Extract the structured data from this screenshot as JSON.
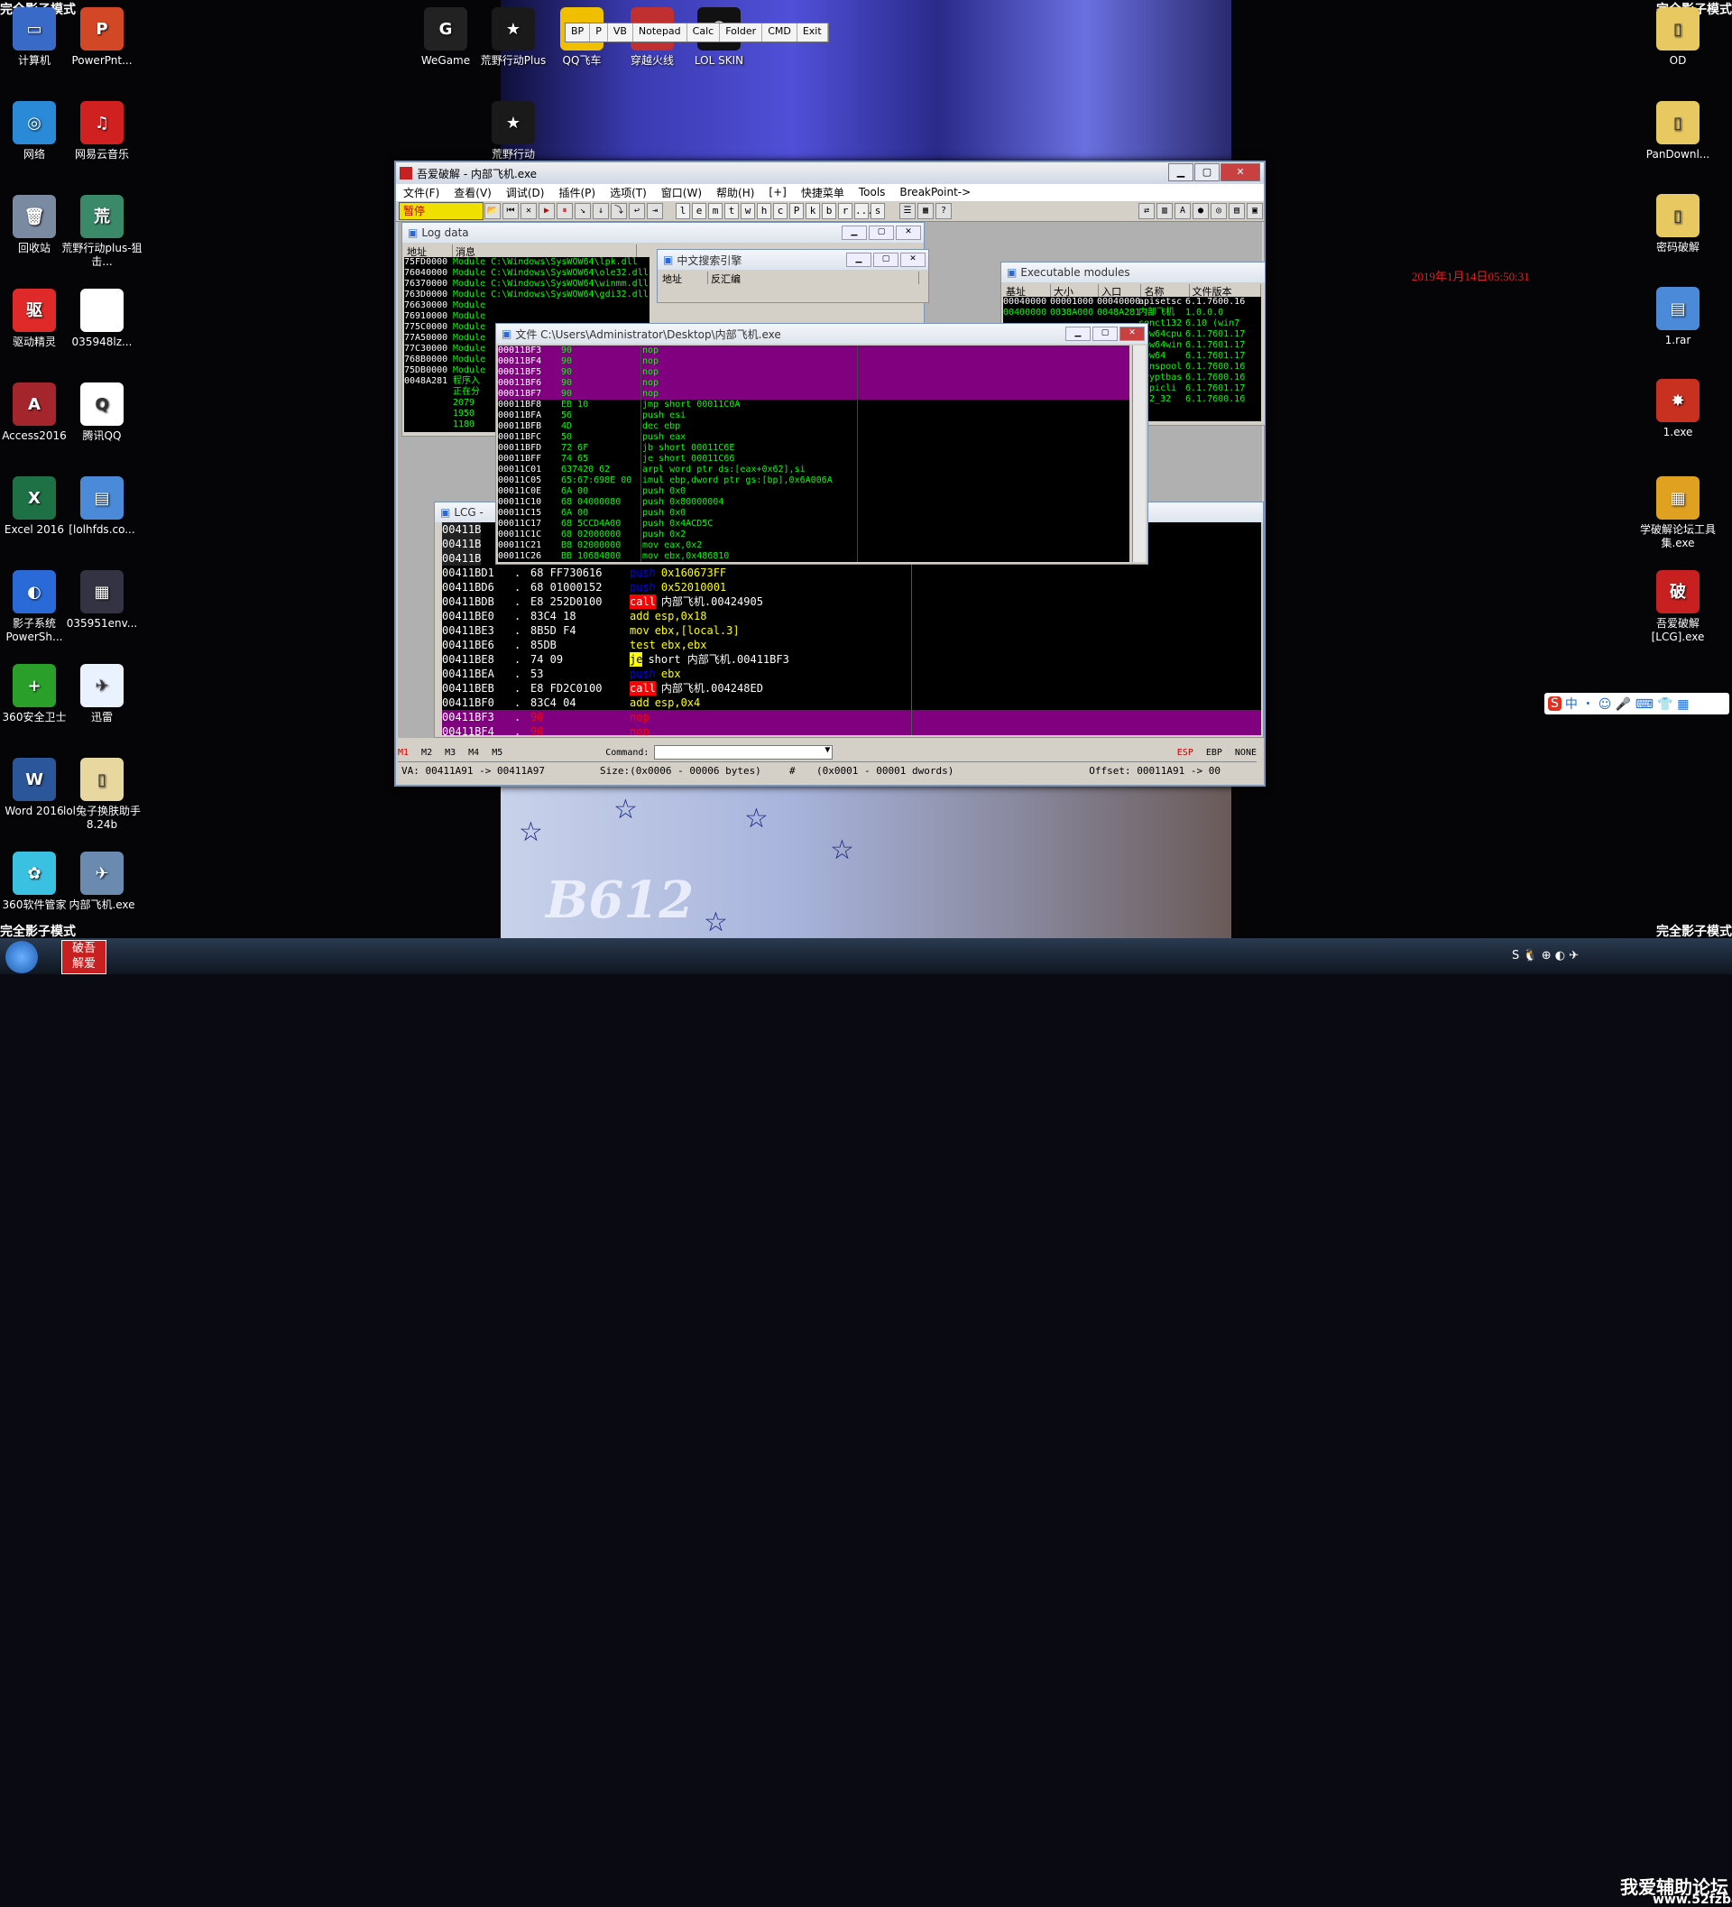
{
  "corners": {
    "tl": "完全影子模式",
    "tr": "完全影子模式",
    "bl": "完全影子模式",
    "br": "完全影子模式"
  },
  "clock": "2019年1月14日05:50:31",
  "desktop_left": [
    {
      "label": "计算机",
      "color": "#3a6ac8",
      "glyph": "▭"
    },
    {
      "label": "PowerPnt...",
      "color": "#d24726",
      "glyph": "P"
    },
    {
      "label": "网络",
      "color": "#2a8ad8",
      "glyph": "◎"
    },
    {
      "label": "网易云音乐",
      "color": "#d02020",
      "glyph": "♫"
    },
    {
      "label": "回收站",
      "color": "#7a8aa0",
      "glyph": "🗑"
    },
    {
      "label": "荒野行动plus-狙击...",
      "color": "#3a8a6a",
      "glyph": "荒"
    },
    {
      "label": "驱动精灵",
      "color": "#e02a2a",
      "glyph": "驱"
    },
    {
      "label": "035948lz...",
      "color": "#ffffff",
      "glyph": ""
    },
    {
      "label": "Access2016",
      "color": "#a4262c",
      "glyph": "A"
    },
    {
      "label": "腾讯QQ",
      "color": "#ffffff",
      "glyph": "Q"
    },
    {
      "label": "Excel 2016",
      "color": "#1e7145",
      "glyph": "X"
    },
    {
      "label": "[lolhfds.co...",
      "color": "#4a8ad8",
      "glyph": "▤"
    },
    {
      "label": "影子系统PowerSh...",
      "color": "#2a6ad8",
      "glyph": "◐"
    },
    {
      "label": "035951env...",
      "color": "#333344",
      "glyph": "▦"
    },
    {
      "label": "360安全卫士",
      "color": "#2aa02a",
      "glyph": "+"
    },
    {
      "label": "迅雷",
      "color": "#eaf2ff",
      "glyph": "✈"
    },
    {
      "label": "Word 2016",
      "color": "#2b579a",
      "glyph": "W"
    },
    {
      "label": "lol兔子换肤助手8.24b",
      "color": "#e8d8a0",
      "glyph": "▯"
    },
    {
      "label": "360软件管家",
      "color": "#3ac0e0",
      "glyph": "✿"
    },
    {
      "label": "内部飞机.exe",
      "color": "#6a8ab0",
      "glyph": "✈"
    }
  ],
  "desktop_top": [
    {
      "label": "WeGame",
      "color": "#222222",
      "glyph": "G"
    },
    {
      "label": "荒野行动Plus",
      "color": "#1a1a1a",
      "glyph": "★"
    },
    {
      "label": "QQ飞车",
      "color": "#f0c000",
      "glyph": "Q"
    },
    {
      "label": "穿越火线",
      "color": "#c03030",
      "glyph": "◉"
    },
    {
      "label": "LOL SKIN",
      "color": "#111111",
      "glyph": "☺"
    },
    {
      "label": "荒野行动",
      "color": "#1a1a1a",
      "glyph": "★"
    }
  ],
  "desktop_right": [
    {
      "label": "OD",
      "color": "#e8c860",
      "glyph": "▯"
    },
    {
      "label": "PanDownl...",
      "color": "#e8c860",
      "glyph": "▯"
    },
    {
      "label": "密码破解",
      "color": "#e8c860",
      "glyph": "▯"
    },
    {
      "label": "1.rar",
      "color": "#4a8ad8",
      "glyph": "▤"
    },
    {
      "label": "1.exe",
      "color": "#c83020",
      "glyph": "✸"
    },
    {
      "label": "学破解论坛工具集.exe",
      "color": "#e0a020",
      "glyph": "▦"
    },
    {
      "label": "吾爱破解[LCG].exe",
      "color": "#c82020",
      "glyph": "破"
    }
  ],
  "quickbar": [
    "BP",
    "P",
    "VB",
    "Notepad",
    "Calc",
    "Folder",
    "CMD",
    "Exit"
  ],
  "window": {
    "title": "吾爱破解 - 内部飞机.exe",
    "menus": [
      "文件(F)",
      "查看(V)",
      "调试(D)",
      "插件(P)",
      "选项(T)",
      "窗口(W)",
      "帮助(H)",
      "[+]",
      "快捷菜单",
      "Tools",
      "BreakPoint->"
    ],
    "pause": "暂停",
    "letters": [
      "l",
      "e",
      "m",
      "t",
      "w",
      "h",
      "c",
      "P",
      "k",
      "b",
      "r",
      "...",
      "s"
    ]
  },
  "log": {
    "title": "Log data",
    "cols": [
      "地址",
      "消息"
    ],
    "rows": [
      [
        "75FD0000",
        "Module C:\\Windows\\SysWOW64\\lpk.dll"
      ],
      [
        "76040000",
        "Module C:\\Windows\\SysWOW64\\ole32.dll"
      ],
      [
        "76370000",
        "Module C:\\Windows\\SysWOW64\\winmm.dll"
      ],
      [
        "763D0000",
        "Module C:\\Windows\\SysWOW64\\gdi32.dll"
      ],
      [
        "76630000",
        "Module"
      ],
      [
        "76910000",
        "Module"
      ],
      [
        "775C0000",
        "Module"
      ],
      [
        "77A50000",
        "Module"
      ],
      [
        "77C30000",
        "Module"
      ],
      [
        "768B0000",
        "Module"
      ],
      [
        "75DB0000",
        "Module"
      ],
      [
        "0048A281",
        "程序入"
      ],
      [
        "",
        "正在分"
      ],
      [
        "",
        "2079"
      ],
      [
        "",
        "1950"
      ],
      [
        "",
        "1180"
      ]
    ]
  },
  "search": {
    "title": "中文搜索引擎",
    "cols": [
      "地址",
      "反汇编"
    ]
  },
  "exec": {
    "title": "Executable modules",
    "cols": [
      "基址",
      "大小",
      "入口",
      "名称",
      "文件版本"
    ],
    "rows": [
      [
        "00040000",
        "00001000",
        "00040000",
        "apisetsc",
        "6.1.7600.16"
      ],
      [
        "00400000",
        "0038A000",
        "0048A281",
        "内部飞机",
        "1.0.0.0"
      ],
      [
        "",
        "",
        "",
        "conct132",
        "6.10 (win7"
      ],
      [
        "",
        "",
        "",
        "wow64cpu",
        "6.1.7601.17"
      ],
      [
        "",
        "",
        "",
        "wow64win",
        "6.1.7601.17"
      ],
      [
        "",
        "",
        "",
        "wow64",
        "6.1.7601.17"
      ],
      [
        "",
        "",
        "",
        "winspool",
        "6.1.7600.16"
      ],
      [
        "",
        "",
        "",
        "cryptbas",
        "6.1.7600.16"
      ],
      [
        "",
        "",
        "",
        "sspicli",
        "6.1.7601.17"
      ],
      [
        "",
        "",
        "",
        "ws2_32",
        "6.1.7600.16"
      ]
    ]
  },
  "file": {
    "title": "文件 C:\\Users\\Administrator\\Desktop\\内部飞机.exe",
    "rows": [
      [
        "00011BF3",
        "90",
        "nop",
        true
      ],
      [
        "00011BF4",
        "90",
        "nop",
        true
      ],
      [
        "00011BF5",
        "90",
        "nop",
        true
      ],
      [
        "00011BF6",
        "90",
        "nop",
        true
      ],
      [
        "00011BF7",
        "90",
        "nop",
        true
      ],
      [
        "00011BF8",
        "EB 10",
        "jmp short 00011C0A",
        false
      ],
      [
        "00011BFA",
        "56",
        "push esi",
        false
      ],
      [
        "00011BFB",
        "4D",
        "dec ebp",
        false
      ],
      [
        "00011BFC",
        "50",
        "push eax",
        false
      ],
      [
        "00011BFD",
        "72 6F",
        "jb short 00011C6E",
        false
      ],
      [
        "00011BFF",
        "74 65",
        "je short 00011C66",
        false
      ],
      [
        "00011C01",
        "637420 62",
        "arpl word ptr ds:[eax+0x62],si",
        false
      ],
      [
        "00011C05",
        "65:67:698E 00",
        "imul ebp,dword ptr gs:[bp],0x6A006A",
        false
      ],
      [
        "00011C0E",
        "6A 00",
        "push 0x0",
        false
      ],
      [
        "00011C10",
        "68 04000080",
        "push 0x80000004",
        false
      ],
      [
        "00011C15",
        "6A 00",
        "push 0x0",
        false
      ],
      [
        "00011C17",
        "68 5CCD4A00",
        "push 0x4ACD5C",
        false
      ],
      [
        "00011C1C",
        "68 02000000",
        "push 0x2",
        false
      ],
      [
        "00011C21",
        "B8 02000000",
        "mov eax,0x2",
        false
      ],
      [
        "00011C26",
        "BB 10684800",
        "mov ebx,0x486810",
        false
      ]
    ]
  },
  "lcg": {
    "title": "LCG -",
    "rows": [
      [
        "00411BD1",
        "68 FF730616",
        "push",
        "0x160673FF"
      ],
      [
        "00411BD6",
        "68 01000152",
        "push",
        "0x52010001"
      ],
      [
        "00411BDB",
        "E8 252D0100",
        "call",
        "内部飞机.00424905"
      ],
      [
        "00411BE0",
        "83C4 18",
        "add",
        "esp,0x18"
      ],
      [
        "00411BE3",
        "8B5D F4",
        "mov",
        "ebx,[local.3]"
      ],
      [
        "00411BE6",
        "85DB",
        "test",
        "ebx,ebx"
      ],
      [
        "00411BE8",
        "74 09",
        "je",
        "short 内部飞机.00411BF3"
      ],
      [
        "00411BEA",
        "53",
        "push",
        "ebx"
      ],
      [
        "00411BEB",
        "E8 FD2C0100",
        "call",
        "内部飞机.004248ED"
      ],
      [
        "00411BF0",
        "83C4 04",
        "add",
        "esp,0x4"
      ],
      [
        "00411BF3",
        "90",
        "nop",
        ""
      ],
      [
        "00411BF4",
        "90",
        "nop",
        ""
      ]
    ],
    "top_rows": [
      "00411B",
      "00411B",
      "00411B"
    ]
  },
  "cmdbar": {
    "tabs": [
      "M1",
      "M2",
      "M3",
      "M4",
      "M5"
    ],
    "command_label": "Command:",
    "regs": [
      "ESP",
      "EBP",
      "NONE"
    ]
  },
  "status": {
    "va": "VA: 00411A91 -> 00411A97",
    "size": "Size:(0x0006 - 00006 bytes)",
    "hash": "#",
    "dwords": "(0x0001 - 00001 dwords)",
    "offset": "Offset: 00011A91 -> 00"
  },
  "watermark": {
    "line1": "我爱辅助论坛",
    "line2": "www.52fzba.com"
  }
}
